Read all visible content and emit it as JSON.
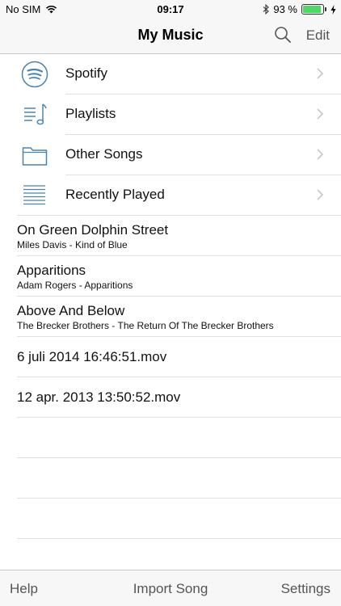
{
  "status_bar": {
    "carrier": "No SIM",
    "time": "09:17",
    "battery_percent_label": "93 %",
    "battery_level": 0.93,
    "icons": [
      "wifi-icon",
      "bluetooth-icon",
      "battery-icon",
      "charging-icon"
    ]
  },
  "nav": {
    "title": "My Music",
    "edit_label": "Edit",
    "search_icon": "search-icon"
  },
  "categories": [
    {
      "label": "Spotify",
      "icon": "spotify-icon"
    },
    {
      "label": "Playlists",
      "icon": "playlist-icon"
    },
    {
      "label": "Other Songs",
      "icon": "folder-icon"
    },
    {
      "label": "Recently Played",
      "icon": "list-icon"
    }
  ],
  "songs": [
    {
      "title": "On Green Dolphin Street",
      "subtitle": "Miles Davis - Kind of Blue"
    },
    {
      "title": "Apparitions",
      "subtitle": "Adam Rogers - Apparitions"
    },
    {
      "title": "Above And Below",
      "subtitle": "The Brecker Brothers - The Return Of The Brecker Brothers"
    },
    {
      "title": "6 juli 2014 16:46:51.mov"
    },
    {
      "title": "12 apr. 2013 13:50:52.mov"
    }
  ],
  "toolbar": {
    "help_label": "Help",
    "import_label": "Import Song",
    "settings_label": "Settings"
  },
  "colors": {
    "icon_blue": "#4a84b0",
    "chevron": "#c7c7cc",
    "separator": "#e0e0e0",
    "bar_background": "#f7f7f7",
    "battery_green": "#4cd964"
  }
}
